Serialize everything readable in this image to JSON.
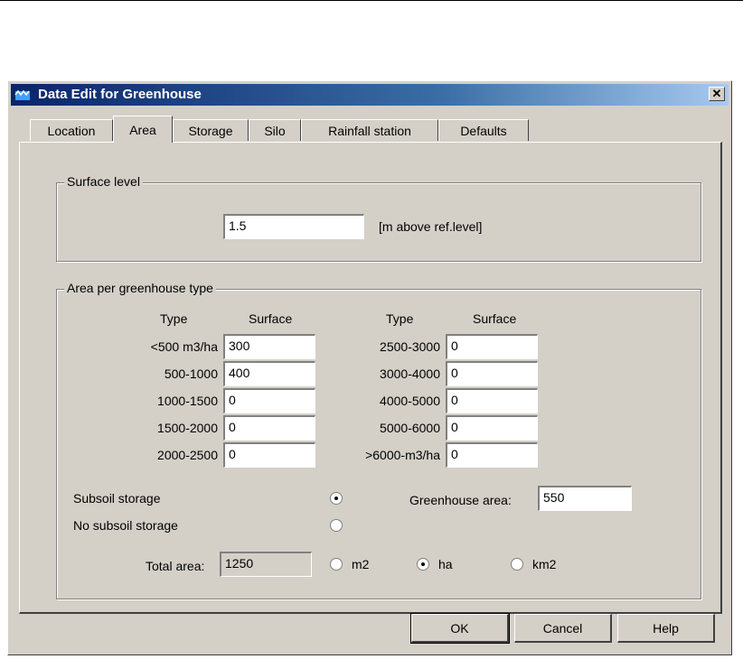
{
  "window": {
    "title": "Data Edit for Greenhouse",
    "close_label": "✕"
  },
  "tabs": [
    {
      "label": "Location"
    },
    {
      "label": "Area"
    },
    {
      "label": "Storage"
    },
    {
      "label": "Silo"
    },
    {
      "label": "Rainfall station"
    },
    {
      "label": "Defaults"
    }
  ],
  "surface_level": {
    "group_label": "Surface level",
    "value": "1.5",
    "unit": "[m above ref.level]"
  },
  "area_group": {
    "group_label": "Area per greenhouse type",
    "col_type": "Type",
    "col_surface": "Surface",
    "left_rows": [
      {
        "type": "<500 m3/ha",
        "surface": "300"
      },
      {
        "type": "500-1000",
        "surface": "400"
      },
      {
        "type": "1000-1500",
        "surface": "0"
      },
      {
        "type": "1500-2000",
        "surface": "0"
      },
      {
        "type": "2000-2500",
        "surface": "0"
      }
    ],
    "right_rows": [
      {
        "type": "2500-3000",
        "surface": "0"
      },
      {
        "type": "3000-4000",
        "surface": "0"
      },
      {
        "type": "4000-5000",
        "surface": "0"
      },
      {
        "type": "5000-6000",
        "surface": "0"
      },
      {
        "type": ">6000-m3/ha",
        "surface": "0"
      }
    ],
    "subsoil_storage_label": "Subsoil storage",
    "subsoil_storage_selected": true,
    "no_subsoil_storage_label": "No subsoil storage",
    "greenhouse_area_label": "Greenhouse area:",
    "greenhouse_area_value": "550",
    "total_area_label": "Total area:",
    "total_area_value": "1250",
    "units": [
      {
        "label": "m2",
        "selected": false
      },
      {
        "label": "ha",
        "selected": true
      },
      {
        "label": "km2",
        "selected": false
      }
    ]
  },
  "buttons": {
    "ok": "OK",
    "cancel": "Cancel",
    "help": "Help"
  }
}
